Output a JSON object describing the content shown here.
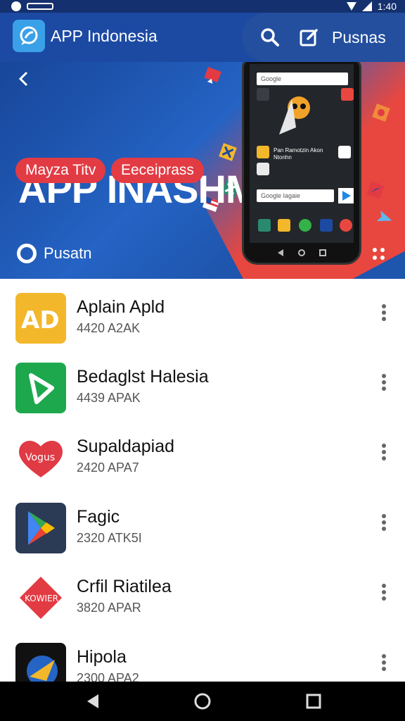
{
  "header": {
    "app_title": "APP Indonesia",
    "right_link": "Pusnas",
    "logo_icon": "speech-bubble-icon",
    "search_icon": "search-icon",
    "edit_icon": "edit-icon"
  },
  "status_bar": {
    "time": "1:40"
  },
  "banner": {
    "title": "APP INASHM R:",
    "chips": [
      "Mayza Titv",
      "Eeceiprass"
    ],
    "bottom_label": "Pusatn",
    "colors": {
      "blue": "#1e55ad",
      "red": "#e8473f"
    },
    "phone": {
      "search_text": "Google",
      "search_bar_text": "Google Iagaie",
      "mid_text": "Pan Ramotzin\nAkon Ntonhn"
    }
  },
  "apps": [
    {
      "name": "Aplain Apld",
      "meta": "4420 A2AK",
      "icon": "ad-logo-icon",
      "icon_text": "AD",
      "icon_color": "#f3b72b"
    },
    {
      "name": "Bedaglst Halesia",
      "meta": "4439 APAK",
      "icon": "play-triangle-icon",
      "icon_text": "",
      "icon_color": "#1ea84d"
    },
    {
      "name": "Supaldapiad",
      "meta": "2420 APA7",
      "icon": "heart-icon",
      "icon_text": "Vogus",
      "icon_color": "#e03a45"
    },
    {
      "name": "Fagic",
      "meta": "2320 ATK5I",
      "icon": "play-store-icon",
      "icon_text": "",
      "icon_color": "#2b3a55"
    },
    {
      "name": "Crfil Riatilea",
      "meta": "3820 APAR",
      "icon": "diamond-icon",
      "icon_text": "KOWIER",
      "icon_color": "#e23b44"
    },
    {
      "name": "Hipola",
      "meta": "2300 APA2",
      "icon": "globe-icon",
      "icon_text": "",
      "icon_color": "#111111"
    }
  ],
  "nav": {
    "back_icon": "back-triangle-icon",
    "home_icon": "home-circle-icon",
    "recent_icon": "recent-square-icon"
  }
}
